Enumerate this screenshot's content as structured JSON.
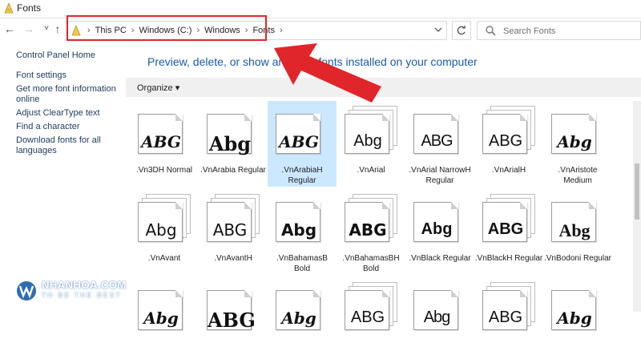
{
  "window": {
    "title": "Fonts"
  },
  "navigation": {
    "back_icon": "arrow-left",
    "forward_icon": "arrow-right",
    "recent_icon": "chevron-down",
    "up_icon": "arrow-up",
    "breadcrumbs": [
      "This PC",
      "Windows (C:)",
      "Windows",
      "Fonts"
    ],
    "refresh_icon": "refresh",
    "search_placeholder": "Search Fonts"
  },
  "sidebar": {
    "items": [
      {
        "label": "Control Panel Home"
      },
      {
        "label": "Font settings"
      },
      {
        "label": "Get more font information online"
      },
      {
        "label": "Adjust ClearType text"
      },
      {
        "label": "Find a character"
      },
      {
        "label": "Download fonts for all languages"
      }
    ]
  },
  "main": {
    "title": "Preview, delete, or show and hide fonts installed on your computer",
    "organize_label": "Organize"
  },
  "fonts": [
    {
      "sample": "ABG",
      "name": ".Vn3DH Normal"
    },
    {
      "sample": "Abg",
      "name": ".VnArabia Regular"
    },
    {
      "sample": "ABG",
      "name": ".VnArabiaH Regular"
    },
    {
      "sample": "Abg",
      "name": ".VnArial"
    },
    {
      "sample": "ABG",
      "name": ".VnArial NarrowH Regular"
    },
    {
      "sample": "ABG",
      "name": ".VnArialH"
    },
    {
      "sample": "Abg",
      "name": ".VnAristote Medium"
    },
    {
      "sample": "Abg",
      "name": ".VnAvant"
    },
    {
      "sample": "ABG",
      "name": ".VnAvantH"
    },
    {
      "sample": "Abg",
      "name": ".VnBahamasB Bold"
    },
    {
      "sample": "ABG",
      "name": ".VnBahamasBH Bold"
    },
    {
      "sample": "Abg",
      "name": ".VnBlack Regular"
    },
    {
      "sample": "ABG",
      "name": ".VnBlackH Regular"
    },
    {
      "sample": "Abg",
      "name": ".VnBodoni Regular"
    },
    {
      "sample": "Abg",
      "name": ""
    },
    {
      "sample": "ABG",
      "name": ""
    },
    {
      "sample": "Abg",
      "name": ""
    },
    {
      "sample": "ABG",
      "name": ""
    },
    {
      "sample": "Abg",
      "name": ""
    },
    {
      "sample": "ABG",
      "name": ""
    },
    {
      "sample": "Abg",
      "name": ""
    }
  ],
  "watermark": {
    "name": "NHANHOA.COM",
    "slogan": "TO BE THE BEST"
  },
  "colors": {
    "highlight": "#e0262b",
    "link": "#1b5ba6",
    "selection": "#cce8ff",
    "arrow": "#e0262b"
  }
}
